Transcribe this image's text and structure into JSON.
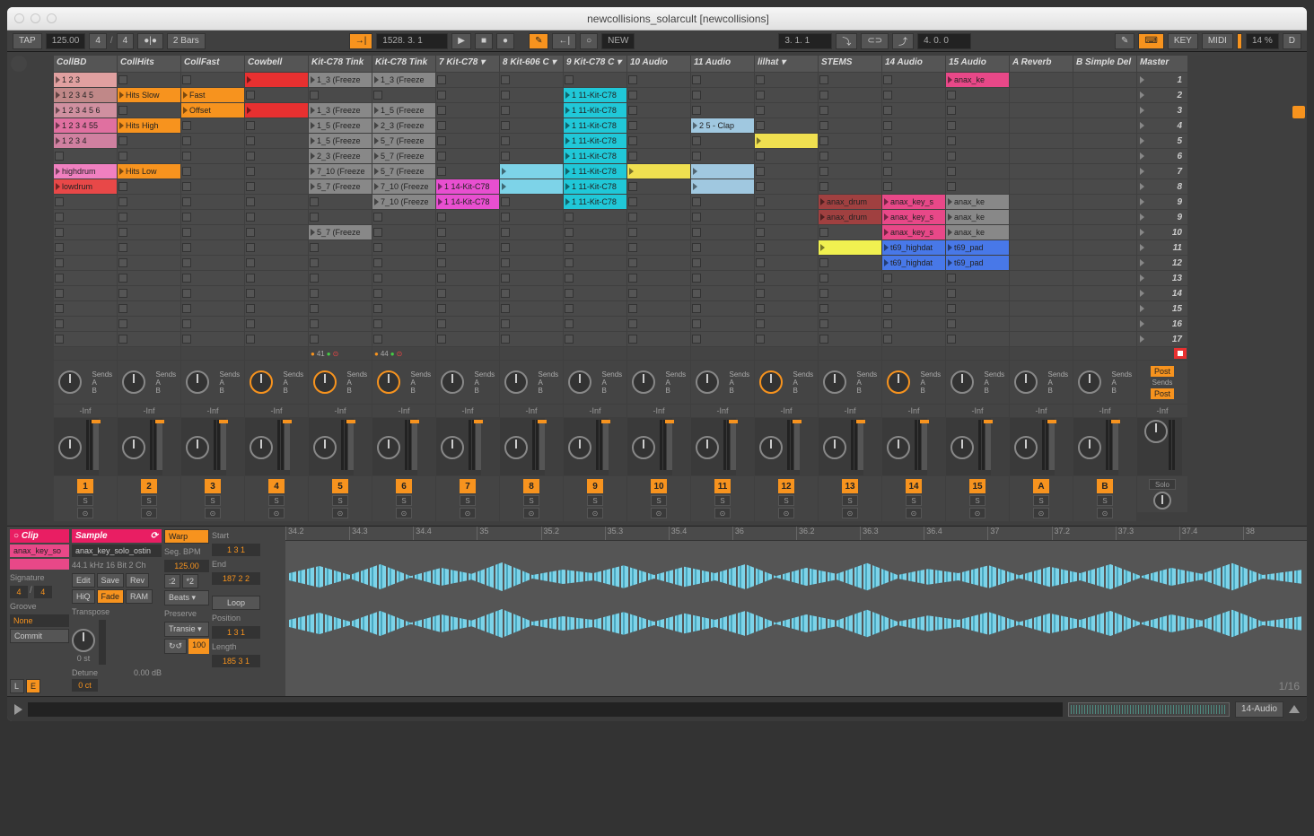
{
  "window": {
    "title": "newcollisions_solarcult  [newcollisions]"
  },
  "toolbar": {
    "tap": "TAP",
    "bpm": "125.00",
    "sig_a": "4",
    "sig_b": "4",
    "quantize": "2 Bars",
    "position": "1528.  3.  1",
    "loop_pos": "3.  1.  1",
    "loop_len": "4.  0.  0",
    "key": "KEY",
    "midi": "MIDI",
    "cpu": "14 %",
    "d": "D",
    "new": "NEW"
  },
  "tracks": [
    {
      "name": "CollBD",
      "num": "1",
      "clips": [
        {
          "label": "1 2 3",
          "color": "#e0a0a0"
        },
        {
          "label": "1 2 3 4 5",
          "color": "#c08888"
        },
        {
          "label": "1 2 3 4 5 6",
          "color": "#d090a0"
        },
        {
          "label": "1 2 3 4 55",
          "color": "#e070a0"
        },
        {
          "label": "1 2 3 4",
          "color": "#d080a0"
        },
        null,
        {
          "label": "highdrum",
          "color": "#f080c0"
        },
        {
          "label": "lowdrum",
          "color": "#e84848"
        },
        null,
        null,
        null,
        null,
        null,
        null,
        null,
        null,
        null
      ]
    },
    {
      "name": "CollHits",
      "num": "2",
      "clips": [
        null,
        {
          "label": "Hits Slow",
          "color": "#f7931e"
        },
        null,
        {
          "label": "Hits High",
          "color": "#f7931e"
        },
        null,
        null,
        {
          "label": "Hits Low",
          "color": "#f7931e"
        },
        null,
        null,
        null,
        null,
        null,
        null,
        null,
        null,
        null,
        null
      ]
    },
    {
      "name": "CollFast",
      "num": "3",
      "clips": [
        null,
        {
          "label": "Fast",
          "color": "#f7931e"
        },
        {
          "label": "Offset",
          "color": "#f7931e"
        },
        null,
        null,
        null,
        null,
        null,
        null,
        null,
        null,
        null,
        null,
        null,
        null,
        null,
        null
      ]
    },
    {
      "name": "Cowbell",
      "num": "4",
      "clips": [
        {
          "label": "",
          "color": "#e83030"
        },
        null,
        {
          "label": "",
          "color": "#e83030"
        },
        null,
        null,
        null,
        null,
        null,
        null,
        null,
        null,
        null,
        null,
        null,
        null,
        null,
        null
      ],
      "knobOrange": true
    },
    {
      "name": "Kit-C78 Tink",
      "num": "5",
      "midiStatus": "41",
      "clips": [
        {
          "label": "1_3 (Freeze",
          "color": "#888"
        },
        null,
        {
          "label": "1_3 (Freeze",
          "color": "#888"
        },
        {
          "label": "1_5 (Freeze",
          "color": "#888"
        },
        {
          "label": "1_5 (Freeze",
          "color": "#888"
        },
        {
          "label": "2_3 (Freeze",
          "color": "#888"
        },
        {
          "label": "7_10 (Freeze",
          "color": "#888"
        },
        {
          "label": "5_7 (Freeze",
          "color": "#888"
        },
        null,
        null,
        {
          "label": "5_7 (Freeze",
          "color": "#888"
        },
        null,
        null,
        null,
        null,
        null,
        null
      ],
      "knobOrange": true
    },
    {
      "name": "Kit-C78 Tink",
      "num": "6",
      "midiStatus": "44",
      "clips": [
        {
          "label": "1_3 (Freeze",
          "color": "#888"
        },
        null,
        {
          "label": "1_5 (Freeze",
          "color": "#888"
        },
        {
          "label": "2_3 (Freeze",
          "color": "#888"
        },
        {
          "label": "5_7 (Freeze",
          "color": "#888"
        },
        {
          "label": "5_7 (Freeze",
          "color": "#888"
        },
        {
          "label": "5_7 (Freeze",
          "color": "#888"
        },
        {
          "label": "7_10 (Freeze",
          "color": "#888"
        },
        {
          "label": "7_10 (Freeze",
          "color": "#888"
        },
        null,
        null,
        null,
        null,
        null,
        null,
        null,
        null
      ],
      "knobOrange": true
    },
    {
      "name": "7 Kit-C78 ▾",
      "num": "7",
      "clips": [
        null,
        null,
        null,
        null,
        null,
        null,
        null,
        {
          "label": "1 14-Kit-C78",
          "color": "#e84fd0"
        },
        {
          "label": "1 14-Kit-C78",
          "color": "#e84fd0"
        },
        null,
        null,
        null,
        null,
        null,
        null,
        null,
        null
      ]
    },
    {
      "name": "8 Kit-606 C ▾",
      "num": "8",
      "clips": [
        null,
        null,
        null,
        null,
        null,
        null,
        {
          "label": "",
          "color": "#7dd3e8"
        },
        {
          "label": "",
          "color": "#7dd3e8"
        },
        null,
        null,
        null,
        null,
        null,
        null,
        null,
        null,
        null
      ]
    },
    {
      "name": "9 Kit-C78 C ▾",
      "num": "9",
      "clips": [
        null,
        {
          "label": "1 11-Kit-C78",
          "color": "#20c8d8"
        },
        {
          "label": "1 11-Kit-C78",
          "color": "#20c8d8"
        },
        {
          "label": "1 11-Kit-C78",
          "color": "#20c8d8"
        },
        {
          "label": "1 11-Kit-C78",
          "color": "#20c8d8"
        },
        {
          "label": "1 11-Kit-C78",
          "color": "#20c8d8"
        },
        {
          "label": "1 11-Kit-C78",
          "color": "#20c8d8"
        },
        {
          "label": "1 11-Kit-C78",
          "color": "#20c8d8"
        },
        {
          "label": "1 11-Kit-C78",
          "color": "#20c8d8"
        },
        null,
        null,
        null,
        null,
        null,
        null,
        null,
        null
      ]
    },
    {
      "name": "10 Audio",
      "num": "10",
      "clips": [
        null,
        null,
        null,
        null,
        null,
        null,
        {
          "label": "",
          "color": "#f0e050"
        },
        null,
        null,
        null,
        null,
        null,
        null,
        null,
        null,
        null,
        null
      ]
    },
    {
      "name": "11 Audio",
      "num": "11",
      "clips": [
        null,
        null,
        null,
        {
          "label": "2 5 - Clap",
          "color": "#a0c8e0"
        },
        null,
        null,
        {
          "label": "",
          "color": "#a0c8e0"
        },
        {
          "label": "",
          "color": "#a0c8e0"
        },
        null,
        null,
        null,
        null,
        null,
        null,
        null,
        null,
        null
      ]
    },
    {
      "name": "lilhat        ▾",
      "num": "12",
      "clips": [
        null,
        null,
        null,
        null,
        {
          "label": "",
          "color": "#f0e050"
        },
        null,
        null,
        null,
        null,
        null,
        null,
        null,
        null,
        null,
        null,
        null,
        null
      ],
      "knobOrange": true
    },
    {
      "name": "STEMS",
      "num": "13",
      "clips": [
        null,
        null,
        null,
        null,
        null,
        null,
        null,
        null,
        {
          "label": "anax_drum",
          "color": "#a04040"
        },
        {
          "label": "anax_drum",
          "color": "#a04040"
        },
        null,
        {
          "label": "",
          "color": "#f0f050"
        },
        null,
        null,
        null,
        null,
        null
      ]
    },
    {
      "name": "14 Audio",
      "num": "14",
      "clips": [
        null,
        null,
        null,
        null,
        null,
        null,
        null,
        null,
        {
          "label": "anax_key_s",
          "color": "#e84888"
        },
        {
          "label": "anax_key_s",
          "color": "#e84888"
        },
        {
          "label": "anax_key_s",
          "color": "#e84888"
        },
        {
          "label": "t69_highdat",
          "color": "#4878e8"
        },
        {
          "label": "t69_highdat",
          "color": "#4878e8"
        },
        null,
        null,
        null,
        null
      ],
      "knobOrange": true
    },
    {
      "name": "15 Audio",
      "num": "15",
      "clips": [
        {
          "label": "anax_ke",
          "color": "#e84888"
        },
        null,
        null,
        null,
        null,
        null,
        null,
        null,
        {
          "label": "anax_ke",
          "color": "#888"
        },
        {
          "label": "anax_ke",
          "color": "#888"
        },
        {
          "label": "anax_ke",
          "color": "#888"
        },
        {
          "label": "t69_pad",
          "color": "#4878e8"
        },
        {
          "label": "t69_pad",
          "color": "#4878e8"
        },
        null,
        null,
        null,
        null
      ]
    }
  ],
  "returns": [
    {
      "name": "A Reverb",
      "num": "A"
    },
    {
      "name": "B Simple Del",
      "num": "B"
    }
  ],
  "master": {
    "name": "Master",
    "post": "Post"
  },
  "scenes": [
    "1",
    "2",
    "3",
    "4",
    "5",
    "6",
    "7",
    "8",
    "9",
    "9",
    "10",
    "11",
    "12",
    "13",
    "14",
    "15",
    "16",
    "17"
  ],
  "mixer": {
    "sends": "Sends",
    "db": "-Inf",
    "solo": "S",
    "sr": "S R"
  },
  "detail": {
    "clip_hdr": "Clip",
    "sample_hdr": "Sample",
    "clip_name": "anax_key_so",
    "sample_name": "anax_key_solo_ostin",
    "format": "44.1 kHz 16 Bit 2 Ch",
    "signature": "Signature",
    "sig_a": "4",
    "sig_b": "4",
    "groove": "Groove",
    "groove_val": "None",
    "commit": "Commit",
    "edit": "Edit",
    "save": "Save",
    "rev": "Rev",
    "hiq": "HiQ",
    "fade": "Fade",
    "ram": "RAM",
    "transpose": "Transpose",
    "st": "0 st",
    "detune": "Detune",
    "ct": "0 ct",
    "gain": "0.00 dB",
    "warp": "Warp",
    "start": "Start",
    "start_v": "1  3  1",
    "seg_bpm": "Seg. BPM",
    "bpm_v": "125.00",
    "end": "End",
    "end_v": "187  2  2",
    "beats": "Beats ▾",
    "mul2": ":2",
    "x2": "*2",
    "preserve": "Preserve",
    "transient": "Transie ▾",
    "mode": "↻↺",
    "hundred": "100",
    "loop": "Loop",
    "position": "Position",
    "pos_v": "1  3  1",
    "length": "Length",
    "len_v": "185  3  1",
    "ruler": [
      "34.2",
      "34.3",
      "34.4",
      "35",
      "35.2",
      "35.3",
      "35.4",
      "36",
      "36.2",
      "36.3",
      "36.4",
      "37",
      "37.2",
      "37.3",
      "37.4",
      "38"
    ],
    "zoom": "1/16"
  },
  "bottom": {
    "track_sel": "14-Audio"
  }
}
